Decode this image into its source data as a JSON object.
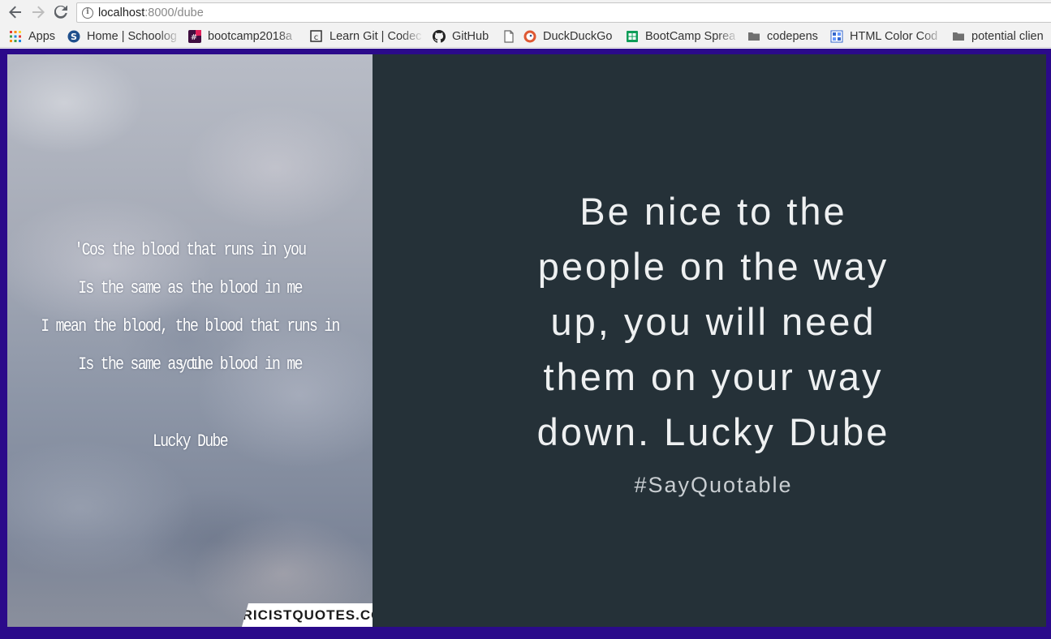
{
  "browser": {
    "url_host": "localhost",
    "url_path": ":8000/dube",
    "nav": {
      "back_icon": "arrow-left",
      "forward_icon": "arrow-right",
      "reload_icon": "reload"
    }
  },
  "bookmarks": [
    {
      "label": "Apps",
      "icon": "apps-grid-icon"
    },
    {
      "label": "Home | Schoolog",
      "icon": "schoology-icon"
    },
    {
      "label": "bootcamp2018a",
      "icon": "slack-icon"
    },
    {
      "label": "Learn Git | Codec",
      "icon": "codecademy-icon"
    },
    {
      "label": "GitHub",
      "icon": "github-icon"
    },
    {
      "label": "DuckDuckGo",
      "icon": "duckduckgo-icon"
    },
    {
      "label": "BootCamp Sprea",
      "icon": "sheets-icon"
    },
    {
      "label": "codepens",
      "icon": "folder-icon"
    },
    {
      "label": "HTML Color Cod",
      "icon": "html-color-icon"
    },
    {
      "label": "potential clien",
      "icon": "folder-icon"
    }
  ],
  "page": {
    "lyrics_image": {
      "lines": [
        "'Cos the blood that runs in you",
        "Is the same as the blood in me",
        "I mean the blood, the blood that runs in you",
        "Is the same as the blood in me"
      ],
      "author": "Lucky Dube",
      "watermark": "LYRICISTQUOTES.COM"
    },
    "quote": {
      "lines": [
        "Be nice to the",
        "people on the way",
        "up, you will need",
        "them on your way",
        "down. Lucky Dube"
      ],
      "hashtag": "#SayQuotable"
    },
    "colors": {
      "frame": "#2b0a8a",
      "card": "#253138",
      "quote_text": "#eef0f1"
    }
  }
}
